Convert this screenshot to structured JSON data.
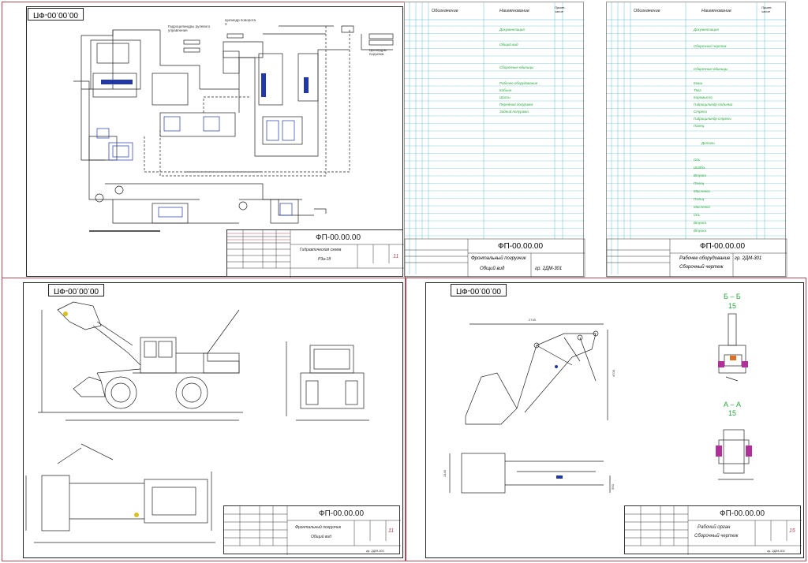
{
  "sheets": {
    "hydraulic": {
      "code_tab": "00.00.00-ФП",
      "stamp_code": "ФП-00.00.00",
      "stamp_title": "Гидравлическая схема",
      "stamp_subtitle": "Р3а-18",
      "sheet_number": "11",
      "labels": {
        "steering": "Гидроцилиндры рулевого управления",
        "bucket_cyl": "Цилиндр поворота 3",
        "lift_cyl": "Цилиндры подъема"
      }
    },
    "spec1": {
      "header_col1": "Обозначение",
      "header_col2": "Наименование",
      "header_col3": "Приме-чание",
      "rows": [
        "Документация",
        "Общий вид",
        "Сборочные единицы",
        "Рабочее оборудование",
        "Кабина",
        "Шасси",
        "Передний полурама",
        "Задний полурама"
      ],
      "stamp_code": "ФП-00.00.00",
      "stamp_title": "Фронтальный погрузчик",
      "stamp_subtitle": "Общий вид",
      "stamp_group": "гр. 2ДМ-301"
    },
    "spec2": {
      "header_col1": "Обозначение",
      "header_col2": "Наименование",
      "header_col3": "Приме-чание",
      "rows": [
        "Документация",
        "Сборочный чертеж",
        "Сборочные единицы",
        "Ковш",
        "Тяга",
        "Коромысло",
        "Гидроцилиндр подъема",
        "Стрела",
        "Гидроцилиндр стрелы",
        "Палец",
        "Детали",
        "Ось",
        "Шайба",
        "Втулка",
        "Палец",
        "Масленка",
        "Пальц",
        "Масленка",
        "Ось",
        "Втулка",
        "Втулка"
      ],
      "stamp_code": "ФП-00.00.00",
      "stamp_title": "Рабочее оборудование",
      "stamp_subtitle": "Сборочный чертеж",
      "stamp_group": "гр. 2ДМ-301"
    },
    "general_view": {
      "code_tab": "00.00.00-ФП",
      "stamp_code": "ФП-00.00.00",
      "stamp_title": "Фронтальный погрузчик",
      "stamp_subtitle": "Общий вид",
      "sheet_number": "11",
      "stamp_group": "гр. 2ДМ-301"
    },
    "working_body": {
      "code_tab": "00.00.00-ФП",
      "section_bb": "Б – Б",
      "section_bb_scale": "15",
      "section_aa": "А – А",
      "section_aa_scale": "15",
      "dim_top": "2745",
      "dim_side": "4700",
      "dim_plan": "2440",
      "dim_plan2": "550",
      "stamp_code": "ФП-00.00.00",
      "stamp_title": "Рабочий орган",
      "stamp_subtitle": "Сборочный чертеж",
      "sheet_number": "15",
      "stamp_group": "гр. 2ДМ-301"
    }
  },
  "colors": {
    "sheet_border": "#b04a58",
    "spec_green": "#24a83a",
    "spec_lines": "#3ab0c0",
    "magenta": "#b0309a",
    "ink": "#222222"
  }
}
